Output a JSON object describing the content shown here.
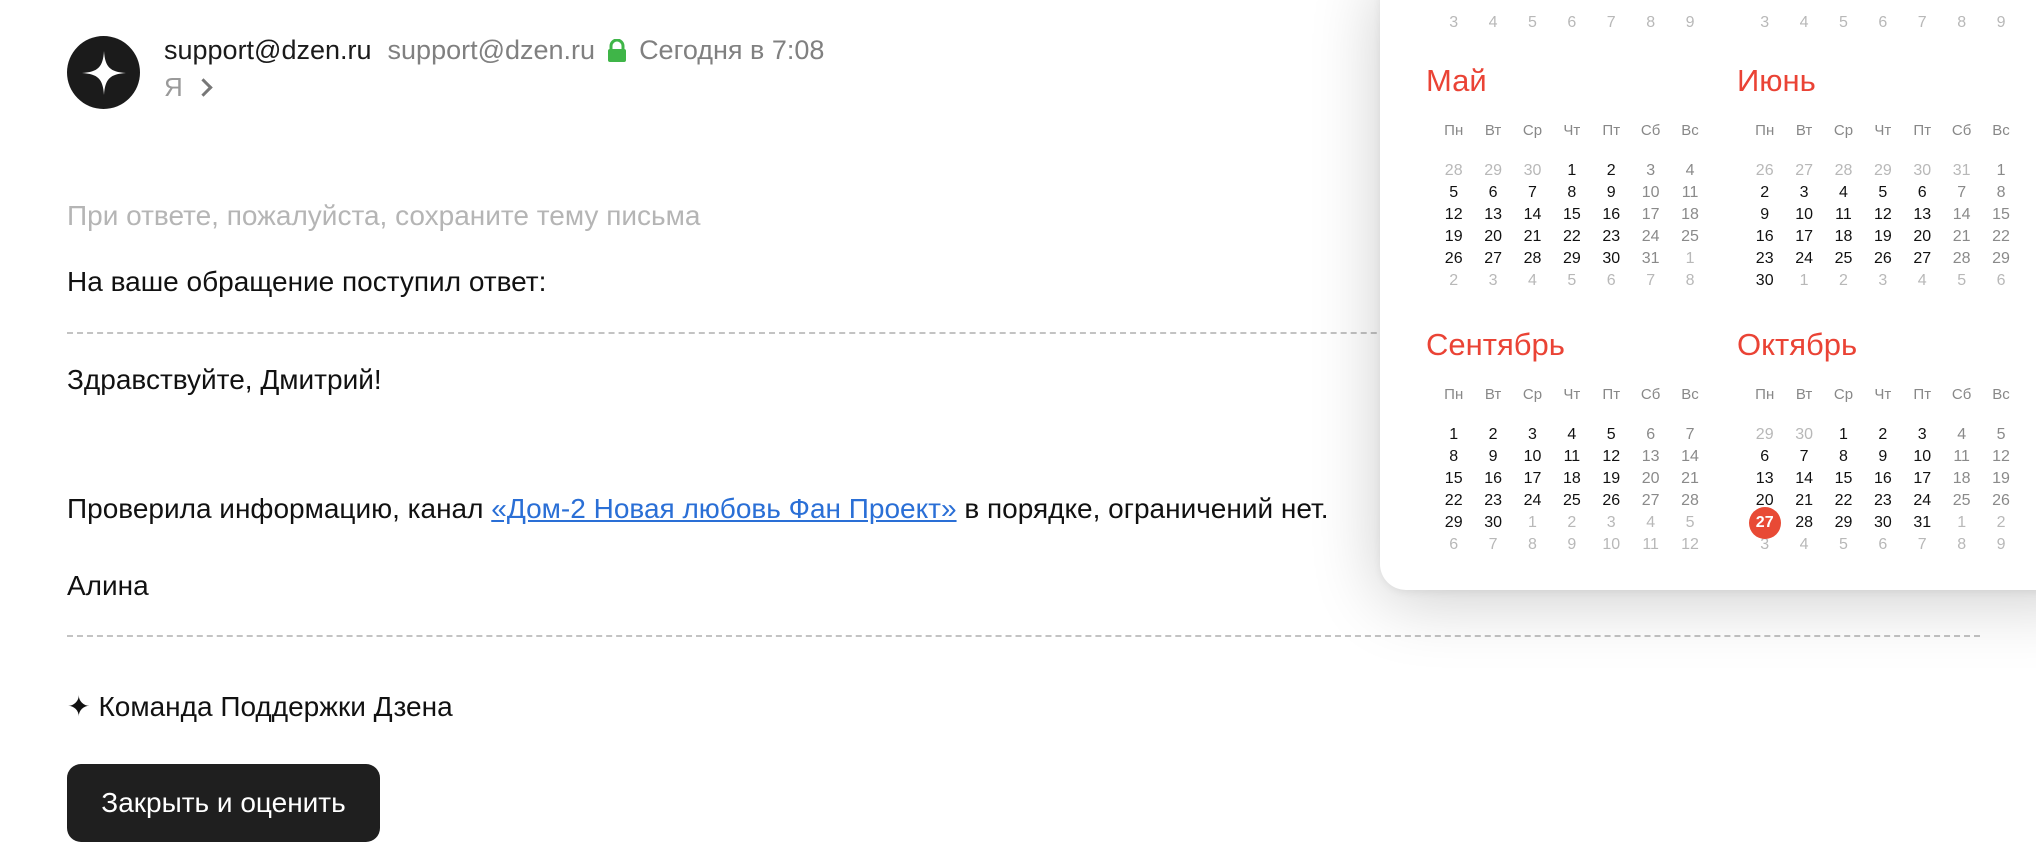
{
  "email": {
    "sender_name": "support@dzen.ru",
    "sender_address": "support@dzen.ru",
    "date": "Сегодня в 7:08",
    "recipient": "Я",
    "hint": "При ответе, пожалуйста, сохраните тему письма",
    "intro": "На ваше обращение поступил ответ:",
    "greeting": "Здравствуйте, Дмитрий!",
    "message_before": "Проверила информацию, канал ",
    "message_link": "«Дом-2 Новая любовь Фан Проект»",
    "message_after": " в порядке, ограничений нет.",
    "signature": "Алина",
    "team_star": "✦",
    "team": "Команда Поддержки Дзена",
    "close_button": "Закрыть и оценить"
  },
  "calendar": {
    "weekdays": [
      "Пн",
      "Вт",
      "Ср",
      "Чт",
      "Пт",
      "Сб",
      "Вс"
    ],
    "prev_row_left": [
      "3",
      "4",
      "5",
      "6",
      "7",
      "8",
      "9"
    ],
    "prev_row_right": [
      "3",
      "4",
      "5",
      "6",
      "7",
      "8",
      "9"
    ],
    "today": "27",
    "months": [
      {
        "name": "Май",
        "first_weekday": 3,
        "days": 31,
        "prev_last": 30
      },
      {
        "name": "Июнь",
        "first_weekday": 6,
        "days": 30,
        "prev_last": 31
      },
      {
        "name": "Сентябрь",
        "first_weekday": 0,
        "days": 30,
        "prev_last": 31
      },
      {
        "name": "Октябрь",
        "first_weekday": 2,
        "days": 31,
        "prev_last": 30
      }
    ]
  },
  "colors": {
    "accent": "#ea4335",
    "today_bg": "#e84a35",
    "link": "#2a6fd6",
    "button_bg": "#1f1f1f"
  }
}
